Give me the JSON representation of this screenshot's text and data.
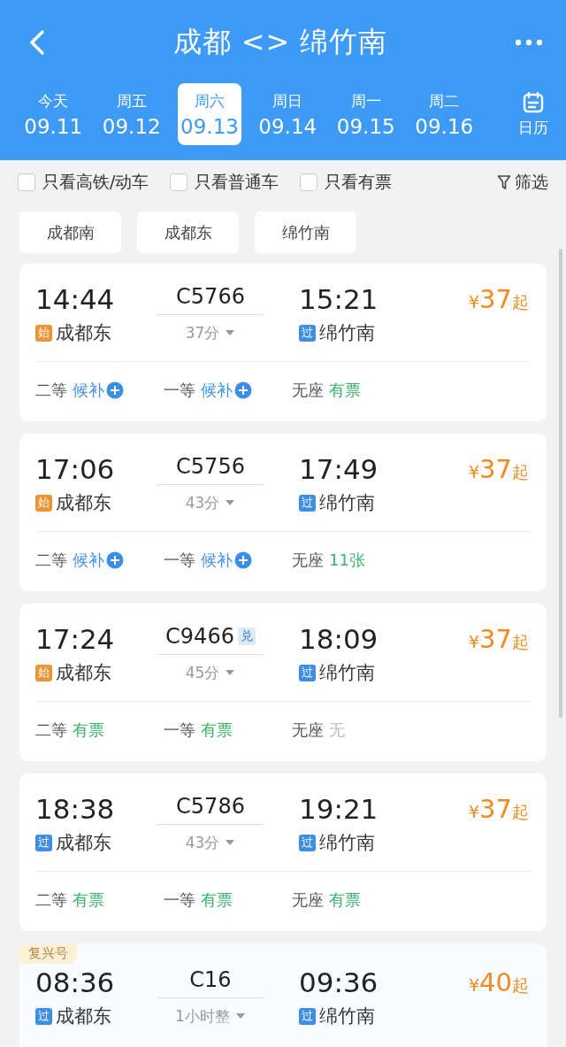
{
  "title": "成都 <> 绵竹南",
  "dates": [
    {
      "weekday": "今天",
      "date": "09.11",
      "selected": false
    },
    {
      "weekday": "周五",
      "date": "09.12",
      "selected": false
    },
    {
      "weekday": "周六",
      "date": "09.13",
      "selected": true
    },
    {
      "weekday": "周日",
      "date": "09.14",
      "selected": false
    },
    {
      "weekday": "周一",
      "date": "09.15",
      "selected": false
    },
    {
      "weekday": "周二",
      "date": "09.16",
      "selected": false
    }
  ],
  "calendar_label": "日历",
  "filters": [
    {
      "label": "只看高铁/动车",
      "checked": false
    },
    {
      "label": "只看普通车",
      "checked": false
    },
    {
      "label": "只看有票",
      "checked": false
    }
  ],
  "filter_button": "筛选",
  "stations": [
    "成都南",
    "成都东",
    "绵竹南"
  ],
  "trains": [
    {
      "depart": "14:44",
      "train_no": "C5766",
      "arrive": "15:21",
      "duration": "37分",
      "from": {
        "mark": "始",
        "kind": "origin",
        "name": "成都东"
      },
      "to": {
        "mark": "过",
        "kind": "pass",
        "name": "绵竹南"
      },
      "price": {
        "currency": "¥",
        "amount": "37",
        "suffix": "起"
      },
      "seats": [
        {
          "class": "二等",
          "status": "候补",
          "kind": "waitlist"
        },
        {
          "class": "一等",
          "status": "候补",
          "kind": "waitlist"
        },
        {
          "class": "无座",
          "status": "有票",
          "kind": "available"
        }
      ]
    },
    {
      "depart": "17:06",
      "train_no": "C5756",
      "arrive": "17:49",
      "duration": "43分",
      "from": {
        "mark": "始",
        "kind": "origin",
        "name": "成都东"
      },
      "to": {
        "mark": "过",
        "kind": "pass",
        "name": "绵竹南"
      },
      "price": {
        "currency": "¥",
        "amount": "37",
        "suffix": "起"
      },
      "seats": [
        {
          "class": "二等",
          "status": "候补",
          "kind": "waitlist"
        },
        {
          "class": "一等",
          "status": "候补",
          "kind": "waitlist"
        },
        {
          "class": "无座",
          "status": "11张",
          "kind": "available"
        }
      ]
    },
    {
      "depart": "17:24",
      "train_no": "C9466",
      "badge": "兑",
      "arrive": "18:09",
      "duration": "45分",
      "from": {
        "mark": "始",
        "kind": "origin",
        "name": "成都东"
      },
      "to": {
        "mark": "过",
        "kind": "pass",
        "name": "绵竹南"
      },
      "price": {
        "currency": "¥",
        "amount": "37",
        "suffix": "起"
      },
      "seats": [
        {
          "class": "二等",
          "status": "有票",
          "kind": "available"
        },
        {
          "class": "一等",
          "status": "有票",
          "kind": "available"
        },
        {
          "class": "无座",
          "status": "无",
          "kind": "none"
        }
      ]
    },
    {
      "depart": "18:38",
      "train_no": "C5786",
      "arrive": "19:21",
      "duration": "43分",
      "from": {
        "mark": "过",
        "kind": "pass",
        "name": "成都东"
      },
      "to": {
        "mark": "过",
        "kind": "pass",
        "name": "绵竹南"
      },
      "price": {
        "currency": "¥",
        "amount": "37",
        "suffix": "起"
      },
      "seats": [
        {
          "class": "二等",
          "status": "有票",
          "kind": "available"
        },
        {
          "class": "一等",
          "status": "有票",
          "kind": "available"
        },
        {
          "class": "无座",
          "status": "有票",
          "kind": "available"
        }
      ]
    },
    {
      "tag": "复兴号",
      "depart": "08:36",
      "train_no": "C16",
      "arrive": "09:36",
      "duration": "1小时整",
      "from": {
        "mark": "过",
        "kind": "pass",
        "name": "成都东"
      },
      "to": {
        "mark": "过",
        "kind": "pass",
        "name": "绵竹南"
      },
      "price": {
        "currency": "¥",
        "amount": "40",
        "suffix": "起"
      }
    }
  ]
}
